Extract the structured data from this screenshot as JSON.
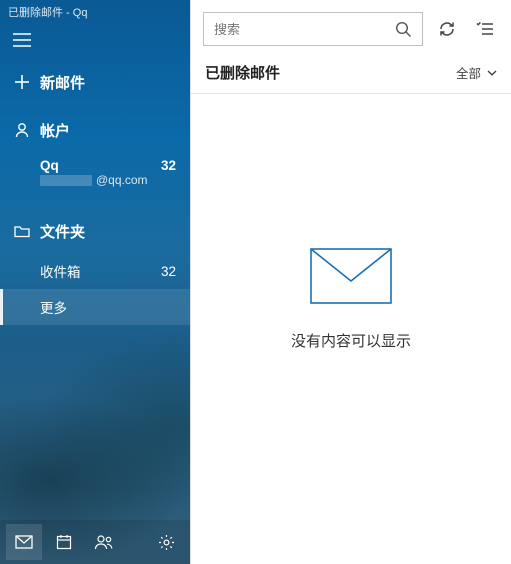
{
  "window": {
    "title": "已删除邮件 - Qq"
  },
  "sidebar": {
    "new_mail": "新邮件",
    "accounts_label": "帐户",
    "account": {
      "name": "Qq",
      "unread": "32",
      "email_suffix": "@qq.com"
    },
    "folders_label": "文件夹",
    "folders": {
      "inbox": {
        "label": "收件箱",
        "count": "32"
      },
      "more": {
        "label": "更多"
      }
    }
  },
  "search": {
    "placeholder": "搜索"
  },
  "content": {
    "heading": "已删除邮件",
    "filter": "全部",
    "empty_message": "没有内容可以显示"
  }
}
